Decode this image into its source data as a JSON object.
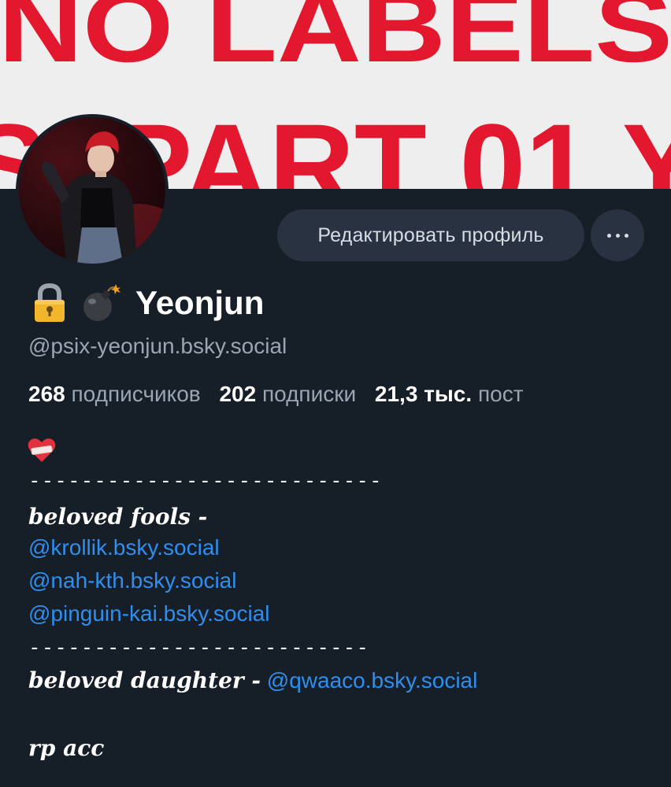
{
  "banner": {
    "text_top": "NO LABELS",
    "text_bottom": "S. PART 01 Y",
    "text_color": "#e3172d"
  },
  "avatar": {
    "description_icon": "avatar"
  },
  "actions": {
    "edit_profile_label": "Редактировать профиль",
    "more_icon": "more-dots-icon"
  },
  "profile": {
    "emoji_1": "lock",
    "emoji_2": "bomb",
    "display_name": "Yeonjun",
    "handle": "@psix-yeonjun.bsky.social"
  },
  "stats": {
    "followers_count": "268",
    "followers_label": "подписчиков",
    "following_count": "202",
    "following_label": "подписки",
    "posts_count": "21,3 тыс.",
    "posts_label": "пост"
  },
  "bio": {
    "heart_icon": "mending-heart-icon",
    "divider_1": "---------------------------",
    "beloved_fools_label": "beloved fools -",
    "links": [
      "@krollik.bsky.social",
      "@nah-kth.bsky.social",
      "@pinguin-kai.bsky.social"
    ],
    "divider_2": "--------------------------",
    "beloved_daughter_label": "beloved daughter -",
    "daughter_link": "@qwaaco.bsky.social",
    "footer": "rp acc"
  },
  "colors": {
    "background": "#161e27",
    "button_bg": "#283240",
    "link": "#2f8ff0",
    "muted_text": "#9aa6b3"
  }
}
